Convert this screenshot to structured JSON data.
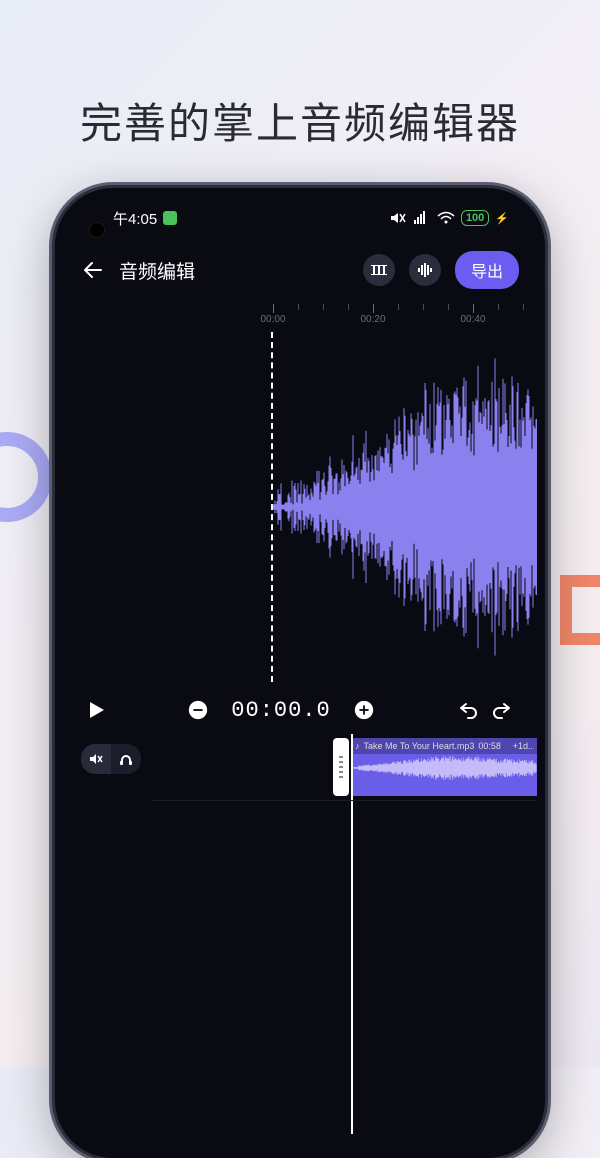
{
  "headline": "完善的掌上音频编辑器",
  "status": {
    "time": "午4:05",
    "battery": "100",
    "charging": "⚡"
  },
  "nav": {
    "title": "音频编辑",
    "export": "导出"
  },
  "ruler": {
    "labels": [
      "00:00",
      "00:20",
      "00:40"
    ]
  },
  "transport": {
    "time": "00:00.0"
  },
  "clip": {
    "filename": "Take Me To Your Heart.mp3",
    "duration": "00:58",
    "extra": "+1d.."
  }
}
